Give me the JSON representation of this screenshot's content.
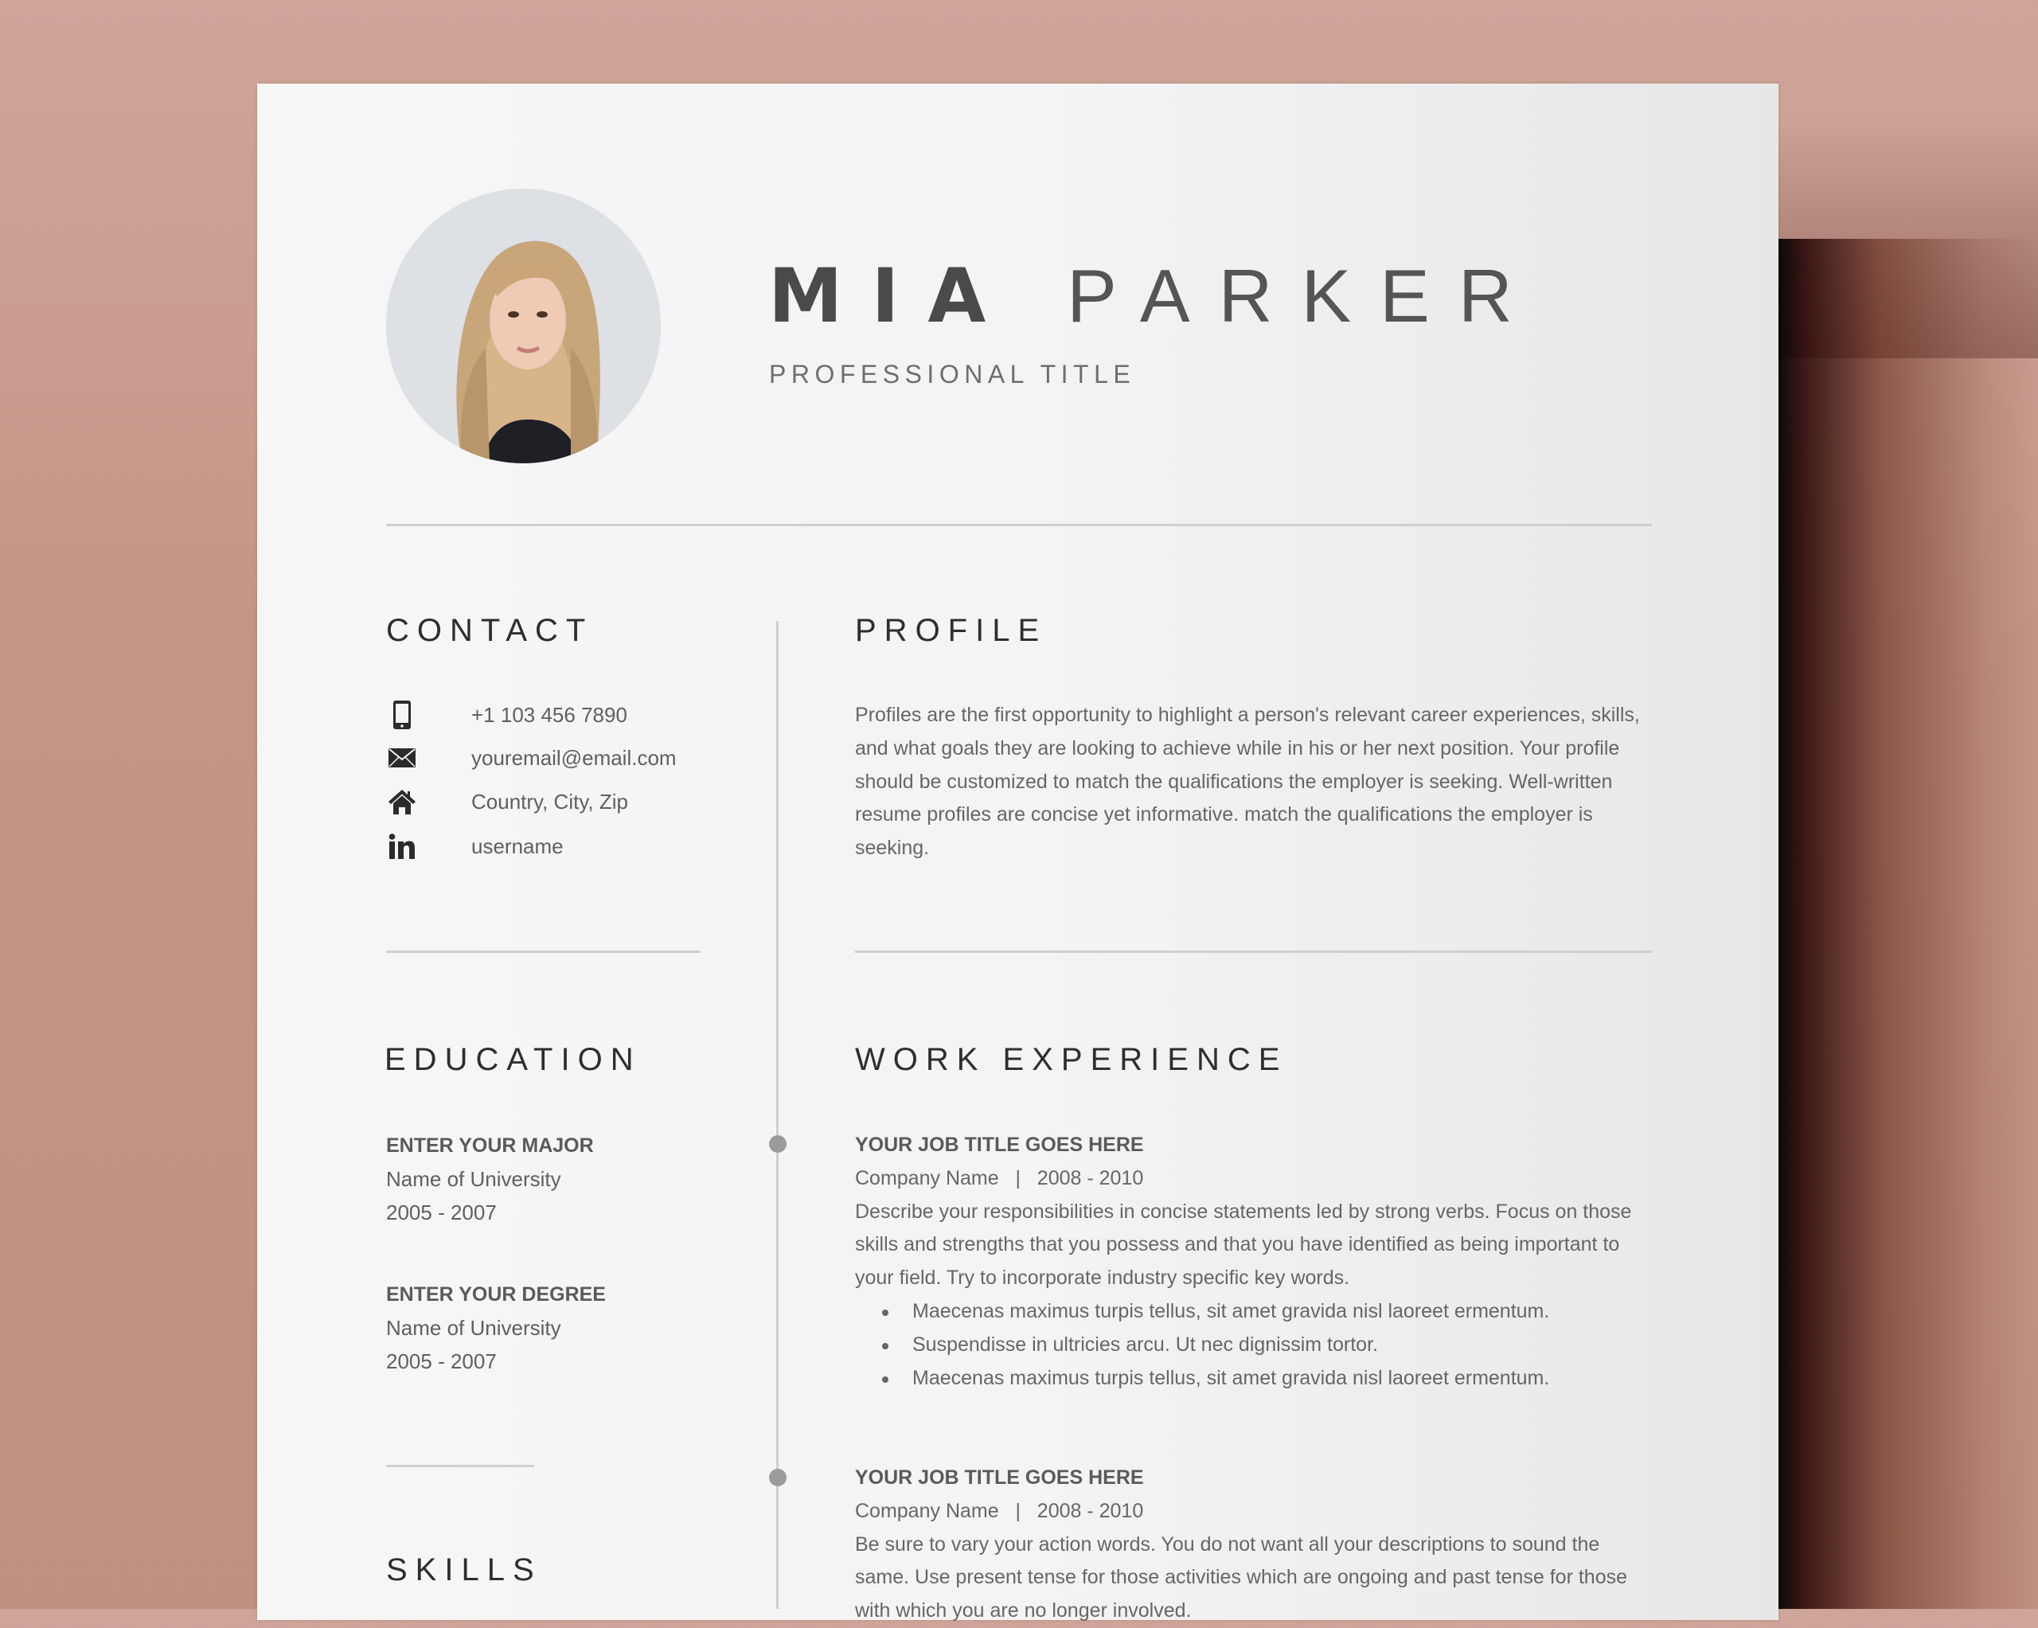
{
  "resume": {
    "name_first": "MIA",
    "name_last": "PARKER",
    "professional_title": "PROFESSIONAL TITLE",
    "photo_alt": "Portrait photo of Mia Parker"
  },
  "contact": {
    "heading": "CONTACT",
    "items": [
      {
        "icon": "phone-icon",
        "text": "+1 103 456 7890"
      },
      {
        "icon": "email-icon",
        "text": "youremail@email.com"
      },
      {
        "icon": "home-icon",
        "text": "Country, City, Zip"
      },
      {
        "icon": "linkedin-icon",
        "text": "username"
      }
    ]
  },
  "profile": {
    "heading": "PROFILE",
    "text": "Profiles are the first opportunity to highlight a person's relevant career experiences, skills, and what goals they are looking to achieve while in his or her next position. Your profile should be customized to match the qualifications the employer is seeking. Well-written resume profiles are concise yet informative. match the qualifications the employer is seeking."
  },
  "education": {
    "heading": "EDUCATION",
    "entries": [
      {
        "title": "ENTER YOUR MAJOR",
        "school": "Name of University",
        "years": "2005 - 2007"
      },
      {
        "title": "ENTER YOUR DEGREE",
        "school": "Name of University",
        "years": "2005 - 2007"
      }
    ]
  },
  "skills": {
    "heading": "SKILLS"
  },
  "work": {
    "heading": "WORK EXPERIENCE",
    "jobs": [
      {
        "title": "YOUR JOB TITLE GOES HERE",
        "company_line": "Company Name   |   2008 - 2010",
        "description": "Describe your responsibilities in concise statements led by strong verbs. Focus on those skills and strengths that you possess and that you have identified as being important to your field. Try to incorporate industry specific key words.",
        "bullets": [
          "Maecenas maximus turpis tellus, sit amet gravida nisl laoreet ermentum.",
          "Suspendisse in ultricies arcu. Ut nec dignissim tortor.",
          "Maecenas maximus turpis tellus, sit amet gravida nisl laoreet ermentum."
        ]
      },
      {
        "title": "YOUR JOB TITLE GOES HERE",
        "company_line": "Company Name   |   2008 - 2010",
        "description": "Be sure to vary your action words. You do not want all your descriptions to sound the same. Use present tense for those activities which are ongoing and past tense for those with which you are no longer involved."
      }
    ]
  },
  "colors": {
    "background_wall": "#c99c8f",
    "paper": "#f5f5f5",
    "heading_text": "#2e2e2e",
    "body_text": "#666666",
    "divider": "#cfcfcf",
    "timeline_dot": "#9b9b9b"
  }
}
